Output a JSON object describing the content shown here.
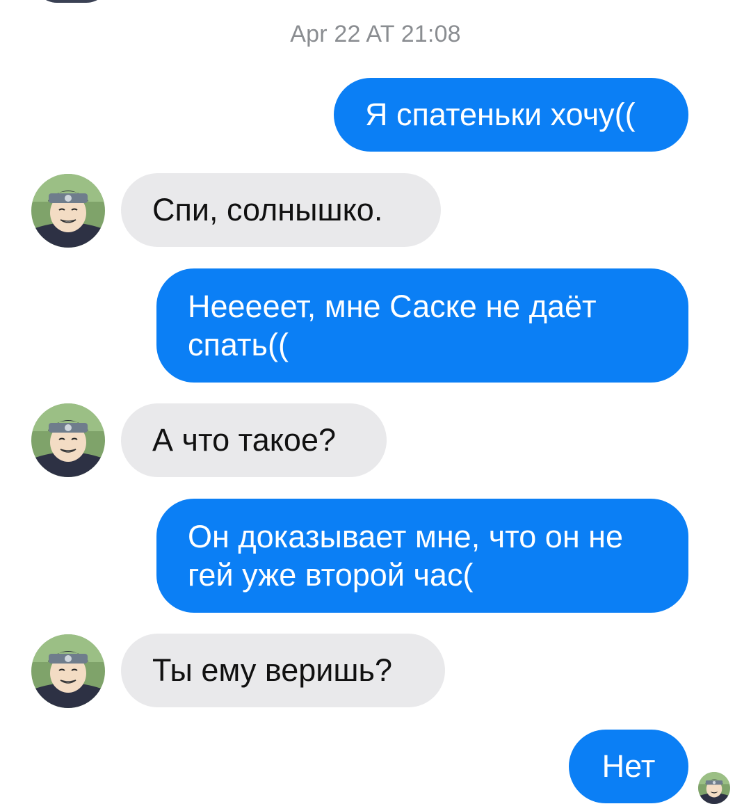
{
  "conversation": {
    "timestamp": "Apr 22 AT 21:08",
    "messages": [
      {
        "direction": "outgoing",
        "text": "Я спатеньки хочу(("
      },
      {
        "direction": "incoming",
        "text": "Спи, солнышко."
      },
      {
        "direction": "outgoing",
        "text": "Нееееет, мне Саске не даёт спать(("
      },
      {
        "direction": "incoming",
        "text": "А что такое?"
      },
      {
        "direction": "outgoing",
        "text": "Он доказывает мне, что он не гей уже второй час("
      },
      {
        "direction": "incoming",
        "text": "Ты ему веришь?"
      },
      {
        "direction": "outgoing",
        "text": "Нет"
      }
    ]
  },
  "colors": {
    "outgoing_bubble": "#0b7ff5",
    "incoming_bubble": "#e9e9eb",
    "timestamp_text": "#8a8d91"
  },
  "icons": {
    "contact_avatar": "anime-character-avatar-icon",
    "read_receipt": "seen-avatar-icon"
  }
}
